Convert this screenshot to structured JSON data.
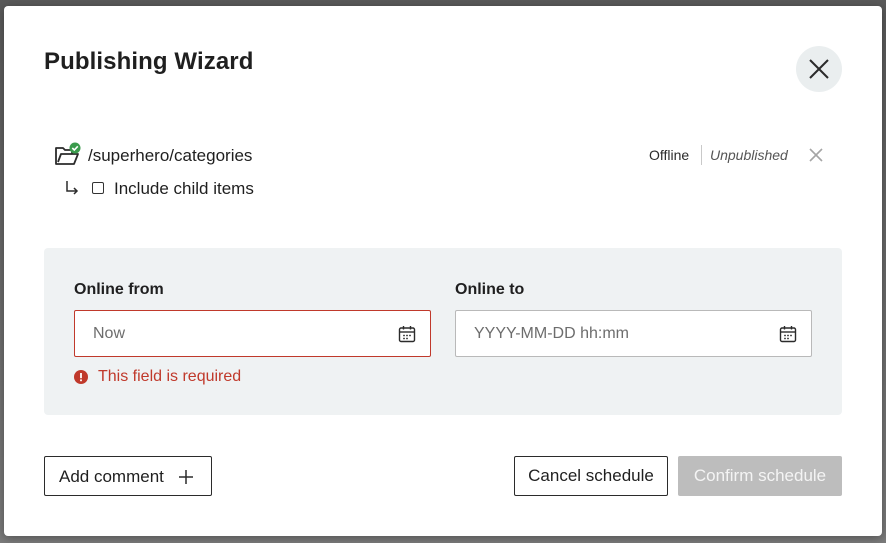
{
  "dialog": {
    "title": "Publishing Wizard",
    "close_icon": "close-icon"
  },
  "item": {
    "path": "/superhero/categories",
    "icon": "folder-open-check-icon",
    "status_online": "Offline",
    "status_publish": "Unpublished",
    "remove_icon": "close-icon"
  },
  "children": {
    "label": "Include child items",
    "checked": false,
    "icon": "arrow-down-right-icon"
  },
  "schedule": {
    "from": {
      "label": "Online from",
      "placeholder": "Now",
      "error": "This field is required",
      "icon": "calendar-icon"
    },
    "to": {
      "label": "Online to",
      "placeholder": "YYYY-MM-DD hh:mm",
      "icon": "calendar-icon"
    }
  },
  "actions": {
    "add_comment": "Add comment",
    "cancel": "Cancel schedule",
    "confirm": "Confirm schedule"
  },
  "colors": {
    "error": "#c0392b",
    "success": "#3a9b4c",
    "panel": "#eff2f3",
    "disabled": "#bdbdbd"
  }
}
